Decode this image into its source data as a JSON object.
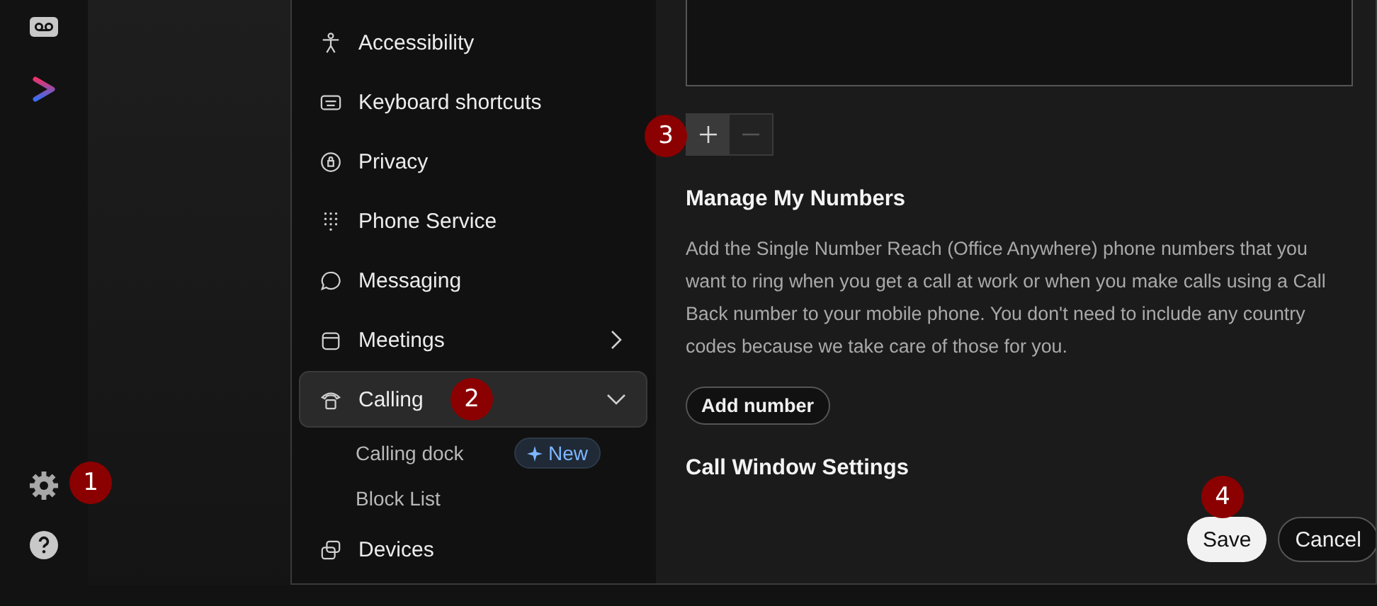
{
  "rail": {
    "top_icons": [
      {
        "kind": "voicemail"
      },
      {
        "kind": "logo"
      }
    ],
    "bottom_icons": [
      {
        "kind": "settings"
      },
      {
        "kind": "help"
      }
    ]
  },
  "sidebar": {
    "items": [
      {
        "label": "Accessibility",
        "selected": false
      },
      {
        "label": "Keyboard shortcuts",
        "selected": false
      },
      {
        "label": "Privacy",
        "selected": false
      },
      {
        "label": "Phone Service",
        "selected": false
      },
      {
        "label": "Messaging",
        "selected": false
      },
      {
        "label": "Meetings",
        "selected": false,
        "expanded": false
      },
      {
        "label": "Calling",
        "selected": true,
        "expanded": true,
        "children": [
          {
            "label": "Calling dock",
            "badge": "New",
            "selected": false
          },
          {
            "label": "Block List",
            "selected": false
          }
        ]
      },
      {
        "label": "Devices",
        "selected": false
      }
    ]
  },
  "content": {
    "stepper": [
      {
        "kind": "add",
        "disabled": false
      },
      {
        "kind": "remove",
        "disabled": true
      }
    ],
    "sections": [
      {
        "heading": "Manage My Numbers",
        "text": "Add the Single Number Reach (Office Anywhere) phone numbers that you want to ring when you get a call at work or when you make calls using a Call Back number to your mobile phone. You don't need to include any country codes because we take care of those for you.",
        "button": "Add number"
      },
      {
        "heading": "Call Window Settings"
      }
    ]
  },
  "buttons": [
    {
      "label": "Save",
      "kind": "primary"
    },
    {
      "label": "Cancel",
      "kind": "secondary"
    }
  ],
  "annotations": [
    "1",
    "2",
    "3",
    "4"
  ]
}
